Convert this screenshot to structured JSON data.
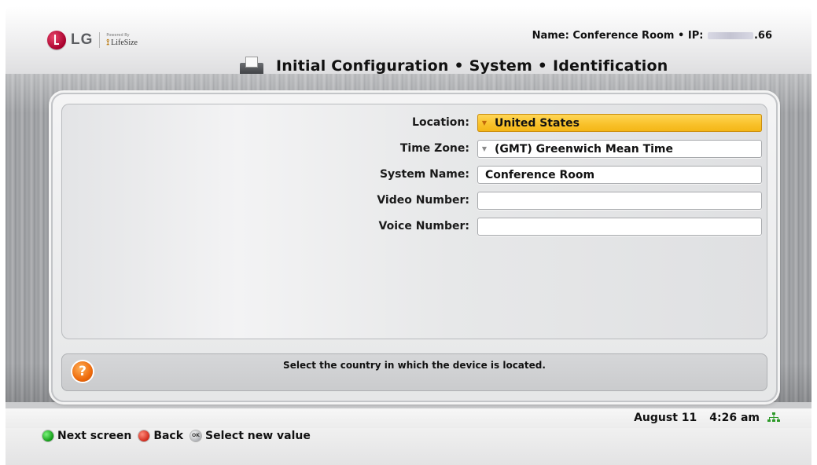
{
  "header": {
    "logo_text": "LG",
    "powered_by": "Powered By",
    "partner": "LifeSize",
    "name_prefix": "Name:",
    "device_name": "Conference Room",
    "ip_prefix": "IP:",
    "ip_visible_suffix": ".66",
    "title": "Initial Configuration • System • Identification"
  },
  "form": {
    "fields": [
      {
        "label": "Location:",
        "value": "United States",
        "dropdown": true,
        "focused": true
      },
      {
        "label": "Time Zone:",
        "value": "(GMT) Greenwich Mean Time",
        "dropdown": true,
        "focused": false
      },
      {
        "label": "System Name:",
        "value": "Conference Room",
        "dropdown": false,
        "focused": false
      },
      {
        "label": "Video Number:",
        "value": "",
        "dropdown": false,
        "focused": false
      },
      {
        "label": "Voice Number:",
        "value": "",
        "dropdown": false,
        "focused": false
      }
    ]
  },
  "help": {
    "icon": "question-icon",
    "text": "Select the country in which the device is located."
  },
  "status": {
    "date": "August 11",
    "time": "4:26 am",
    "network_icon": "network-icon"
  },
  "hints": [
    {
      "label": "Next screen",
      "color": "green",
      "icon": "green-button-icon"
    },
    {
      "label": "Back",
      "color": "red",
      "icon": "red-button-icon"
    },
    {
      "label": "Select new value",
      "color": "ok",
      "icon": "ok-button-icon",
      "glyph": "OK"
    }
  ],
  "colors": {
    "focus": "#f9c22c",
    "help_icon": "#ee6b0c"
  }
}
